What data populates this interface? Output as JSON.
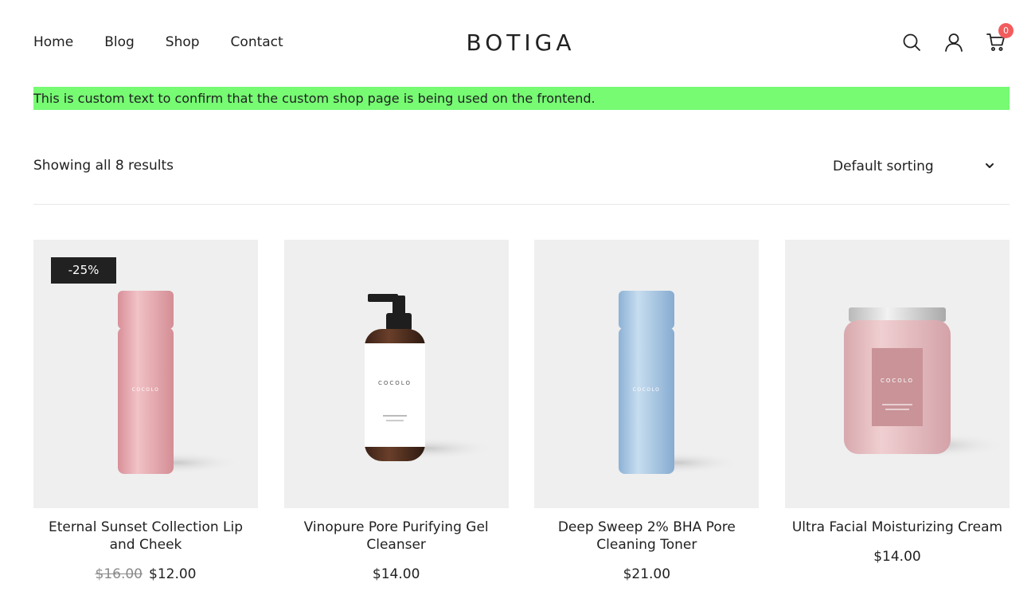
{
  "header": {
    "nav": [
      "Home",
      "Blog",
      "Shop",
      "Contact"
    ],
    "logo": "BOTIGA",
    "icons": [
      "search-icon",
      "user-icon",
      "cart-icon"
    ],
    "cart_count": "0"
  },
  "notice": "This is custom text to confirm that the custom shop page is being used on the frontend.",
  "toolbar": {
    "result_count": "Showing all 8 results",
    "sorting": "Default sorting"
  },
  "products": [
    {
      "title": "Eternal Sunset Collection Lip and Cheek",
      "old_price": "$16.00",
      "price": "$12.00",
      "badge": "-25%",
      "brand": "COCOLO"
    },
    {
      "title": "Vinopure Pore Purifying Gel Cleanser",
      "price": "$14.00",
      "brand": "COCOLO"
    },
    {
      "title": "Deep Sweep 2% BHA Pore Cleaning Toner",
      "price": "$21.00",
      "brand": "COCOLO"
    },
    {
      "title": "Ultra Facial Moisturizing Cream",
      "price": "$14.00",
      "brand": "COCOLO"
    }
  ],
  "colors": {
    "notice_bg": "#76fb73",
    "badge_bg": "#212121",
    "cart_badge": "#f25c5c",
    "tile_bg": "#efefef"
  }
}
